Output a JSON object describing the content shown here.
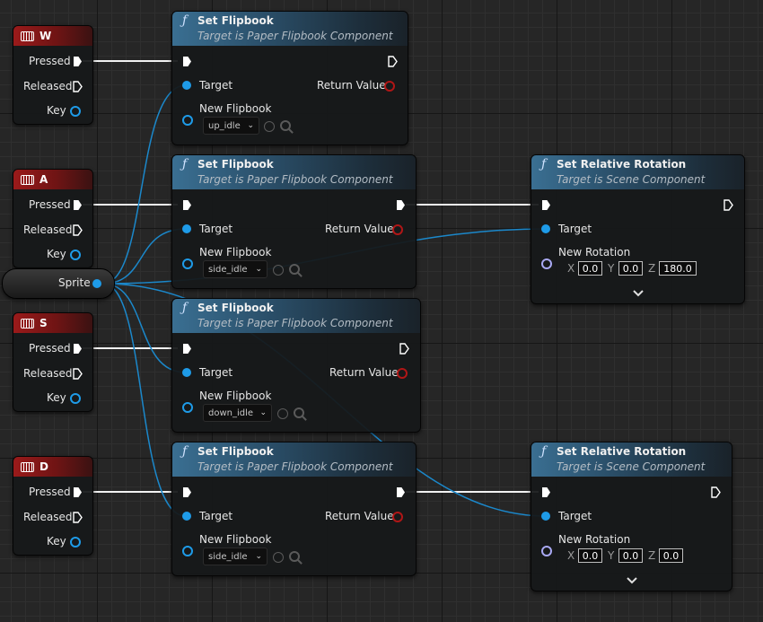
{
  "key_events": [
    {
      "key": "W",
      "pins": {
        "pressed": "Pressed",
        "released": "Released",
        "key": "Key"
      }
    },
    {
      "key": "A",
      "pins": {
        "pressed": "Pressed",
        "released": "Released",
        "key": "Key"
      }
    },
    {
      "key": "S",
      "pins": {
        "pressed": "Pressed",
        "released": "Released",
        "key": "Key"
      }
    },
    {
      "key": "D",
      "pins": {
        "pressed": "Pressed",
        "released": "Released",
        "key": "Key"
      }
    }
  ],
  "sprite_node": {
    "label": "Sprite"
  },
  "set_flipbook_nodes": [
    {
      "title": "Set Flipbook",
      "subtitle": "Target is Paper Flipbook Component",
      "target": "Target",
      "return_value": "Return Value",
      "new_flipbook": "New Flipbook",
      "flipbook_value": "up_idle"
    },
    {
      "title": "Set Flipbook",
      "subtitle": "Target is Paper Flipbook Component",
      "target": "Target",
      "return_value": "Return Value",
      "new_flipbook": "New Flipbook",
      "flipbook_value": "side_idle"
    },
    {
      "title": "Set Flipbook",
      "subtitle": "Target is Paper Flipbook Component",
      "target": "Target",
      "return_value": "Return Value",
      "new_flipbook": "New Flipbook",
      "flipbook_value": "down_idle"
    },
    {
      "title": "Set Flipbook",
      "subtitle": "Target is Paper Flipbook Component",
      "target": "Target",
      "return_value": "Return Value",
      "new_flipbook": "New Flipbook",
      "flipbook_value": "side_idle"
    }
  ],
  "set_rotation_nodes": [
    {
      "title": "Set Relative Rotation",
      "subtitle": "Target is Scene Component",
      "target": "Target",
      "new_rotation": "New Rotation",
      "x_label": "X",
      "y_label": "Y",
      "z_label": "Z",
      "x": "0.0",
      "y": "0.0",
      "z": "180.0"
    },
    {
      "title": "Set Relative Rotation",
      "subtitle": "Target is Scene Component",
      "target": "Target",
      "new_rotation": "New Rotation",
      "x_label": "X",
      "y_label": "Y",
      "z_label": "Z",
      "x": "0.0",
      "y": "0.0",
      "z": "0.0"
    }
  ],
  "colors": {
    "key_header": "#9b1a1a",
    "function_header": "#3a6f92",
    "object_pin": "#1e9be8",
    "exec_pin": "#ffffff",
    "return_pin": "#b01616",
    "rotator_pin": "#a9a9f4",
    "background": "#262626"
  },
  "icons": {
    "key_event": "keyboard-icon",
    "function": "function-icon",
    "browse": "browse-arrow-icon",
    "search": "search-icon",
    "expand": "chevron-down-icon"
  }
}
